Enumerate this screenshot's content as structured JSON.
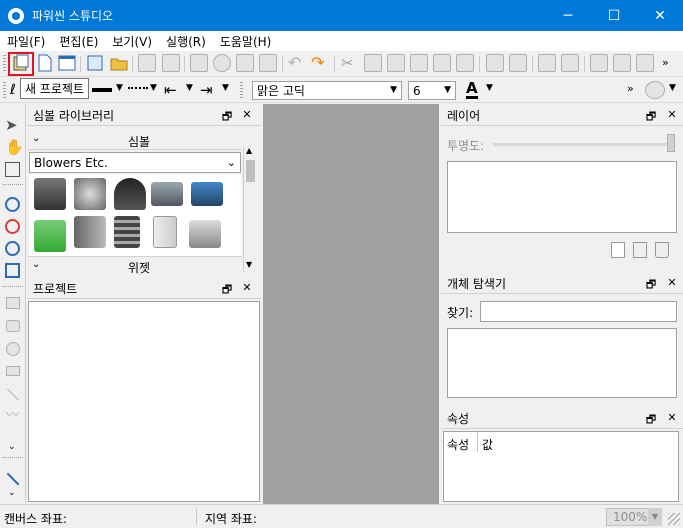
{
  "window": {
    "title": "파워씬 스튜디오",
    "minimize": "─",
    "maximize": "☐",
    "close": "✕"
  },
  "menu": {
    "file": "파일(F)",
    "edit": "편집(E)",
    "view": "보기(V)",
    "run": "실행(R)",
    "help": "도움말(H)"
  },
  "tooltip": "새 프로젝트",
  "format": {
    "font": "맑은 고딕",
    "size": "6",
    "text_color_glyph": "A"
  },
  "symbol_library": {
    "title": "심볼 라이브러리",
    "section_symbol": "심볼",
    "category": "Blowers Etc.",
    "section_widget": "위젯"
  },
  "project": {
    "title": "프로젝트"
  },
  "layers": {
    "title": "레이어",
    "transparency_label": "투명도:"
  },
  "object_explorer": {
    "title": "개체 탐색기",
    "search_label": "찾기:",
    "search_value": ""
  },
  "properties": {
    "title": "속성",
    "col_property": "속성",
    "col_value": "값"
  },
  "status": {
    "canvas_coord": "캔버스 좌표:",
    "local_coord": "지역 좌표:",
    "zoom": "100%"
  },
  "colors": {
    "titlebar": "#0078d7",
    "tooltip_highlight": "#e81123",
    "canvas": "#a0a0a0"
  }
}
